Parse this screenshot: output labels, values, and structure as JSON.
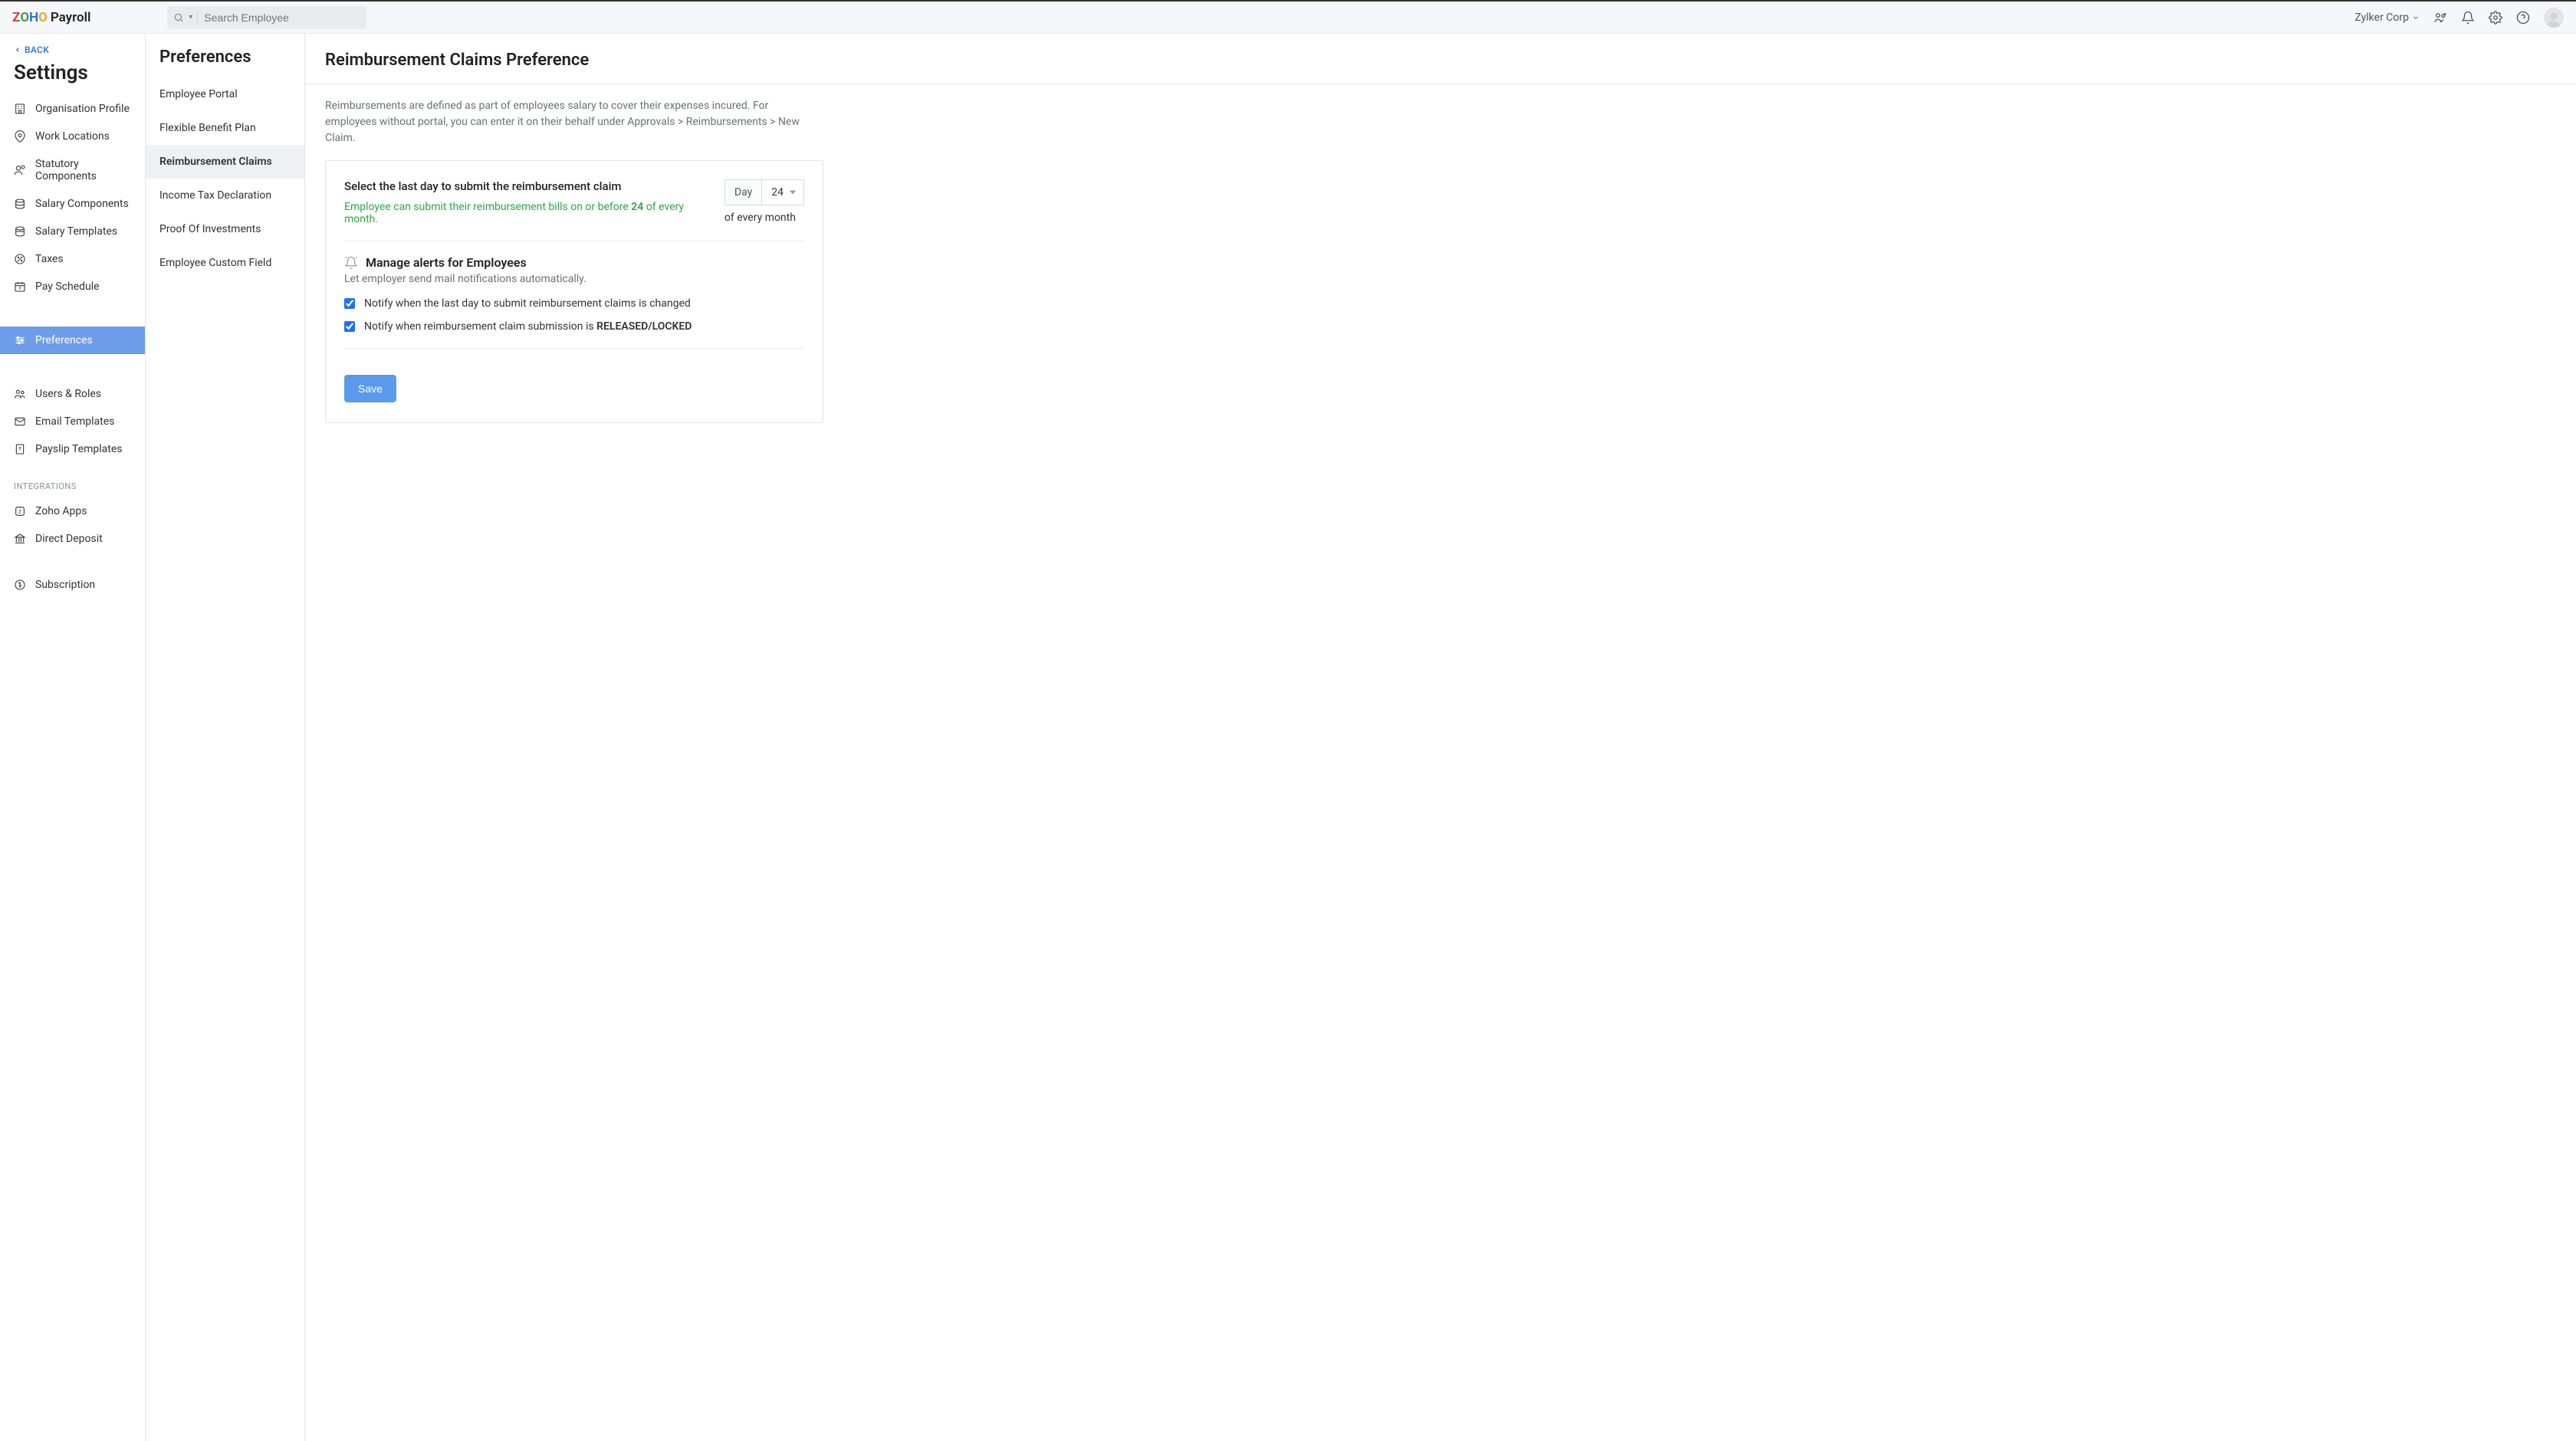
{
  "header": {
    "brand": "Payroll",
    "search_placeholder": "Search Employee",
    "org_name": "Zylker Corp"
  },
  "sidebar": {
    "back_label": "BACK",
    "title": "Settings",
    "items": [
      "Organisation Profile",
      "Work Locations",
      "Statutory Components",
      "Salary Components",
      "Salary Templates",
      "Taxes",
      "Pay Schedule"
    ],
    "active_item": "Preferences",
    "items2": [
      "Users & Roles",
      "Email Templates",
      "Payslip Templates"
    ],
    "section_label": "INTEGRATIONS",
    "items3": [
      "Zoho Apps",
      "Direct Deposit"
    ],
    "items4": [
      "Subscription"
    ]
  },
  "subnav": {
    "title": "Preferences",
    "items": [
      "Employee Portal",
      "Flexible Benefit Plan",
      "Reimbursement Claims",
      "Income Tax Declaration",
      "Proof Of Investments",
      "Employee Custom Field"
    ],
    "active_index": 2
  },
  "content": {
    "title": "Reimbursement Claims Preference",
    "desc": "Reimbursements are defined as part of employees salary to cover their expenses incured. For employees without portal, you can enter it on their behalf under Approvals > Reimbursements > New Claim.",
    "field_label": "Select the last day to submit the reimbursement claim",
    "hint_pre": "Employee can submit their reimbursement bills on or before ",
    "hint_day": "24",
    "hint_post": " of every month.",
    "day_label": "Day",
    "day_value": "24",
    "day_sub": "of every month",
    "alerts_title": "Manage alerts for Employees",
    "alerts_desc": "Let employer send mail notifications automatically.",
    "check1": "Notify when the last day to submit reimbursement claims is changed",
    "check2_pre": "Notify when reimbursement claim submission is ",
    "check2_b": "RELEASED/LOCKED",
    "save_label": "Save"
  }
}
